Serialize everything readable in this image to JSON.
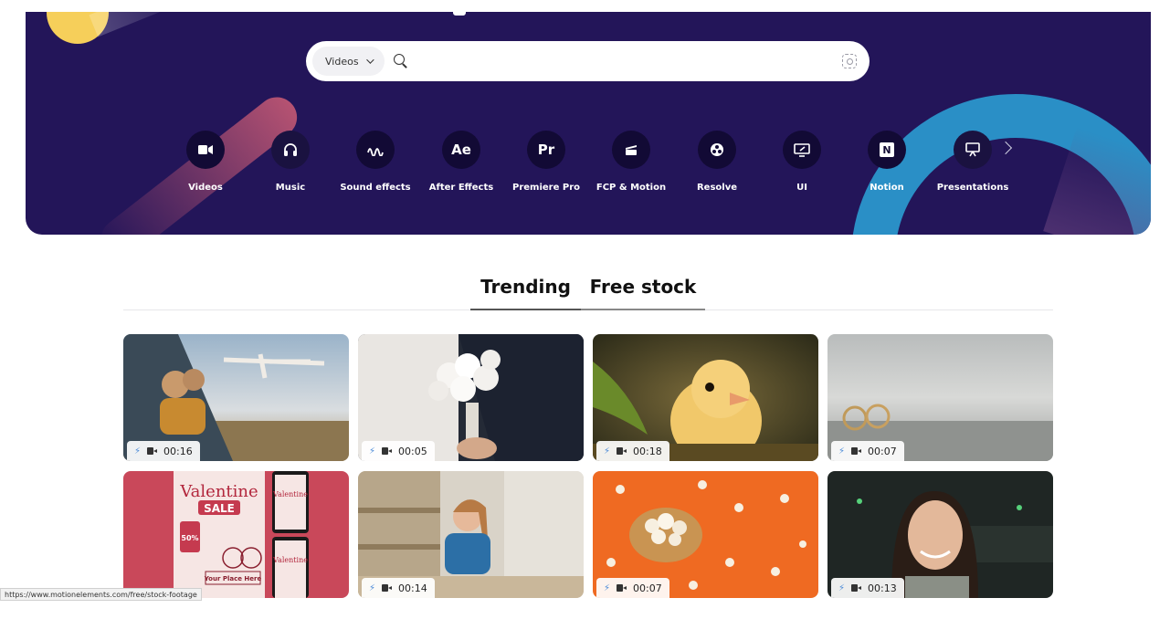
{
  "search": {
    "type_label": "Videos",
    "placeholder": ""
  },
  "categories": [
    {
      "label": "Videos",
      "icon": "video-camera-icon"
    },
    {
      "label": "Music",
      "icon": "headphones-icon"
    },
    {
      "label": "Sound effects",
      "icon": "sound-wave-icon"
    },
    {
      "label": "After Effects",
      "icon": "after-effects-icon",
      "glyph": "Ae"
    },
    {
      "label": "Premiere Pro",
      "icon": "premiere-pro-icon",
      "glyph": "Pr"
    },
    {
      "label": "FCP & Motion",
      "icon": "clapperboard-icon"
    },
    {
      "label": "Resolve",
      "icon": "resolve-icon"
    },
    {
      "label": "UI",
      "icon": "ui-monitor-icon"
    },
    {
      "label": "Notion",
      "icon": "notion-icon",
      "glyph": "N"
    },
    {
      "label": "Presentations",
      "icon": "presentation-icon"
    }
  ],
  "tabs": [
    {
      "label": "Trending"
    },
    {
      "label": "Free stock"
    }
  ],
  "cards": [
    {
      "duration": "00:16",
      "scene": "kids-with-plane"
    },
    {
      "duration": "00:05",
      "scene": "bridal-bouquet"
    },
    {
      "duration": "00:18",
      "scene": "chick"
    },
    {
      "duration": "00:07",
      "scene": "wedding-rings"
    },
    {
      "duration": "",
      "scene": "valentine-sale",
      "poster_title": "Valentine",
      "poster_sub": "SALE",
      "poster_discount": "50%",
      "poster_cta": "Your Place Here"
    },
    {
      "duration": "00:14",
      "scene": "girl-at-table"
    },
    {
      "duration": "00:07",
      "scene": "popcorn"
    },
    {
      "duration": "00:13",
      "scene": "smiling-woman"
    }
  ],
  "status_url": "https://www.motionelements.com/free/stock-footage",
  "colors": {
    "hero_bg": "#231559",
    "ring": "#2a8fc6",
    "sun": "#f6cf5a"
  }
}
